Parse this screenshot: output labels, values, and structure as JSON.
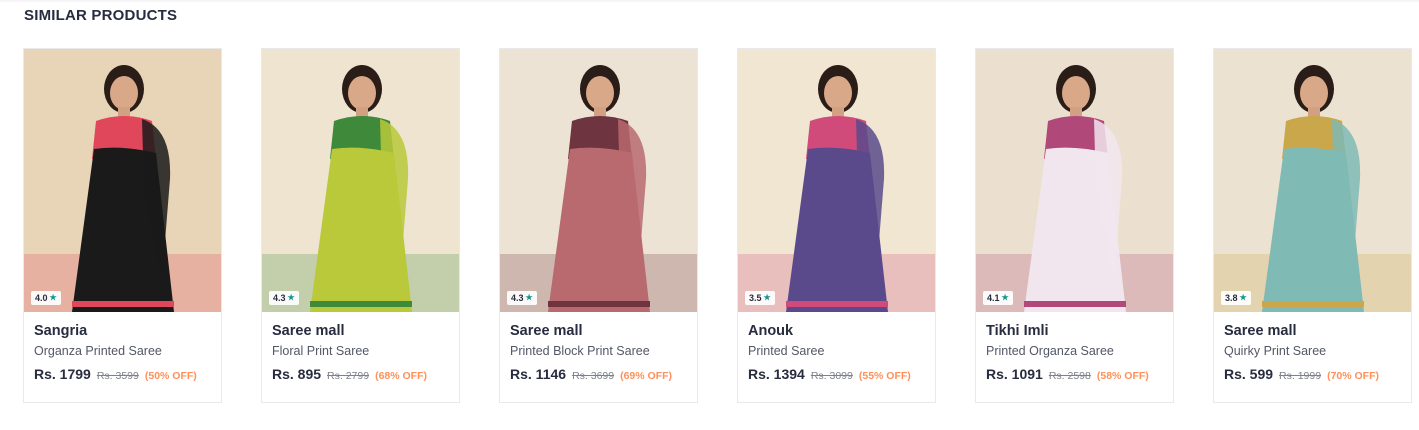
{
  "section": {
    "title": "SIMILAR PRODUCTS"
  },
  "products": [
    {
      "brand": "Sangria",
      "name": "Organza Printed Saree",
      "price": "Rs. 1799",
      "mrp": "Rs. 3599",
      "discount": "(50% OFF)",
      "rating": "4.0",
      "bg": "#e8d5b7",
      "saree": "#1a1a1a",
      "accent": "#e0475b"
    },
    {
      "brand": "Saree mall",
      "name": "Floral Print Saree",
      "price": "Rs. 895",
      "mrp": "Rs. 2799",
      "discount": "(68% OFF)",
      "rating": "4.3",
      "bg": "#efe4cf",
      "saree": "#b9c93a",
      "accent": "#3e8a3a"
    },
    {
      "brand": "Saree mall",
      "name": "Printed Block Print Saree",
      "price": "Rs. 1146",
      "mrp": "Rs. 3699",
      "discount": "(69% OFF)",
      "rating": "4.3",
      "bg": "#ece3d5",
      "saree": "#b86a6f",
      "accent": "#6e3440"
    },
    {
      "brand": "Anouk",
      "name": "Printed Saree",
      "price": "Rs. 1394",
      "mrp": "Rs. 3099",
      "discount": "(55% OFF)",
      "rating": "3.5",
      "bg": "#f0e6d2",
      "saree": "#5a4a8c",
      "accent": "#d04a7a"
    },
    {
      "brand": "Tikhi Imli",
      "name": "Printed Organza Saree",
      "price": "Rs. 1091",
      "mrp": "Rs. 2598",
      "discount": "(58% OFF)",
      "rating": "4.1",
      "bg": "#ebe0cf",
      "saree": "#f2e6ee",
      "accent": "#b0487a"
    },
    {
      "brand": "Saree mall",
      "name": "Quirky Print Saree",
      "price": "Rs. 599",
      "mrp": "Rs. 1999",
      "discount": "(70% OFF)",
      "rating": "3.8",
      "bg": "#ece2d1",
      "saree": "#7fbab5",
      "accent": "#c9a74a"
    }
  ]
}
